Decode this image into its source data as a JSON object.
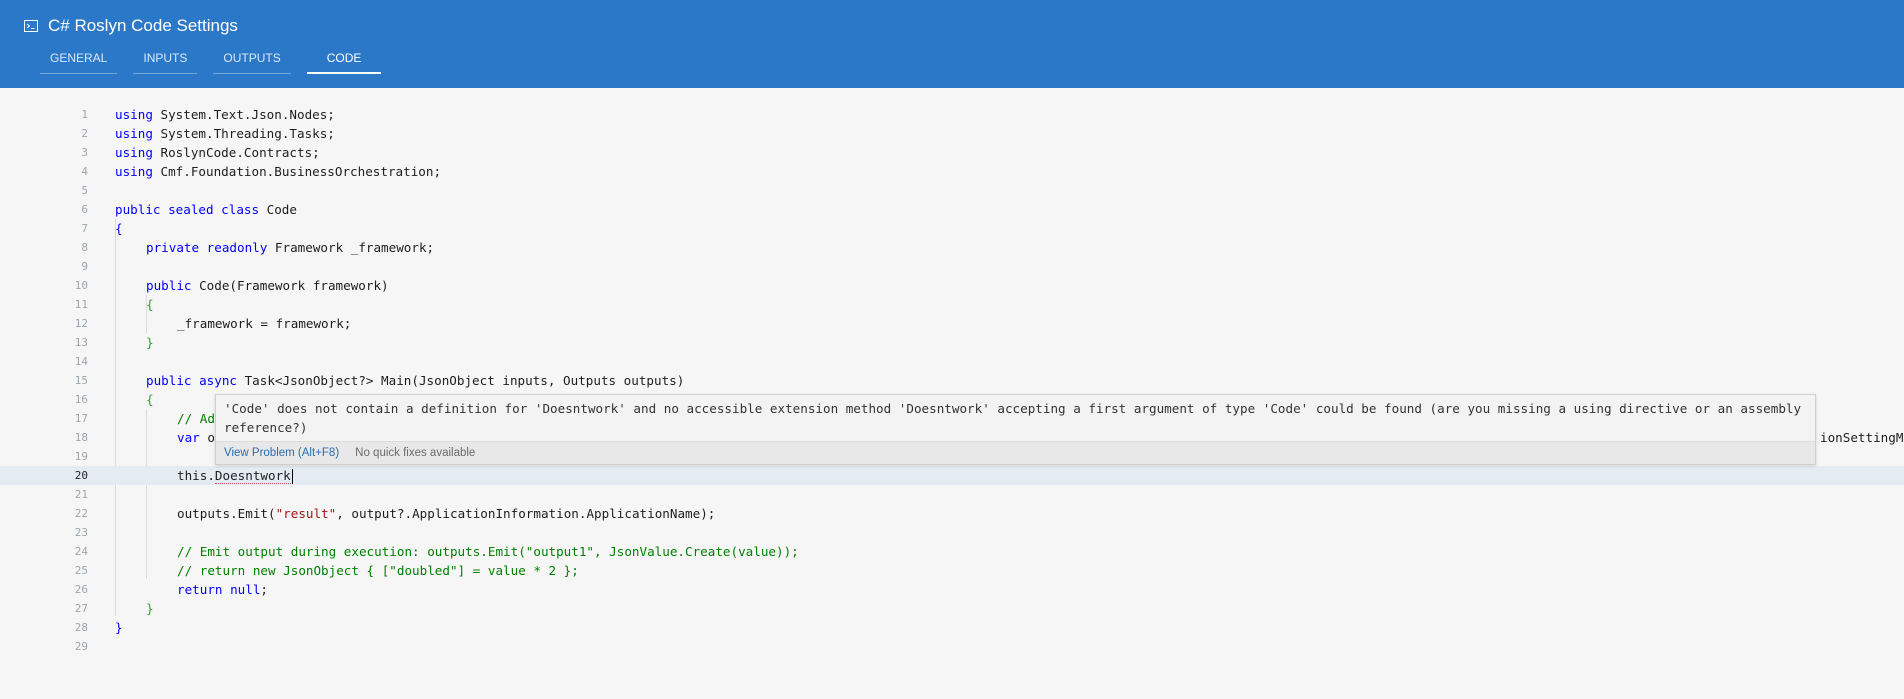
{
  "window": {
    "title": "C# Roslyn Code Settings",
    "title_icon": "terminal-icon"
  },
  "tabs": [
    {
      "label": "GENERAL",
      "active": false
    },
    {
      "label": "INPUTS",
      "active": false
    },
    {
      "label": "OUTPUTS",
      "active": false
    },
    {
      "label": "CODE",
      "active": true
    }
  ],
  "editor": {
    "current_line": "20",
    "line_numbers": [
      "1",
      "2",
      "3",
      "4",
      "5",
      "6",
      "7",
      "8",
      "9",
      "10",
      "11",
      "12",
      "13",
      "14",
      "15",
      "16",
      "17",
      "18",
      "19",
      "20",
      "21",
      "22",
      "23",
      "24",
      "25",
      "26",
      "27",
      "28",
      "29"
    ],
    "lines": {
      "l1_kw": "using",
      "l1_rest": " System.Text.Json.Nodes;",
      "l2_kw": "using",
      "l2_rest": " System.Threading.Tasks;",
      "l3_kw": "using",
      "l3_rest": " RoslynCode.Contracts;",
      "l4_kw": "using",
      "l4_rest": " Cmf.Foundation.BusinessOrchestration;",
      "l6_kw": "public sealed class",
      "l6_rest": " Code",
      "l7": "{",
      "l8_kw": "private readonly",
      "l8_rest": " Framework _framework;",
      "l10_kw": "public",
      "l10_rest": " Code(Framework framework)",
      "l11": "{",
      "l12": "_framework = framework;",
      "l13": "}",
      "l15_kw": "public async",
      "l15_rest": " Task<JsonObject?> Main(JsonObject inputs, Outputs outputs)",
      "l16": "{",
      "l17_cm": "// Ad",
      "l18_kw": "var",
      "l18_rest": " o",
      "l18_tail": "ionSettingMa",
      "l20_this": "this.",
      "l20_err": "Doesntwork",
      "l22_a": "outputs.Emit(",
      "l22_str": "\"result\"",
      "l22_b": ", output?.ApplicationInformation.ApplicationName);",
      "l24_cm": "// Emit output during execution: outputs.Emit(\"output1\", JsonValue.Create(value));",
      "l25_cm": "// return new JsonObject { [\"doubled\"] = value * 2 };",
      "l26_kw": "return null",
      "l26_rest": ";",
      "l27": "}",
      "l28": "}"
    }
  },
  "tooltip": {
    "message": "'Code' does not contain a definition for 'Doesntwork' and no accessible extension method 'Doesntwork' accepting a first argument of type 'Code' could be found (are you missing a using directive or an assembly reference?)",
    "view_problem": "View Problem (Alt+F8)",
    "no_quick_fixes": "No quick fixes available"
  },
  "colors": {
    "header": "#2b78c8",
    "keyword": "#0000ff",
    "string": "#a31515",
    "comment": "#008000"
  }
}
